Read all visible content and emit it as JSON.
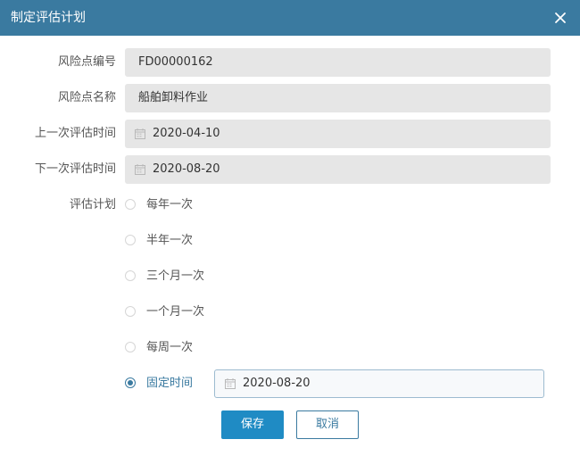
{
  "dialog": {
    "title": "制定评估计划",
    "close_icon": "close-icon"
  },
  "form": {
    "risk_code": {
      "label": "风险点编号",
      "value": "FD00000162"
    },
    "risk_name": {
      "label": "风险点名称",
      "value": "船舶卸料作业"
    },
    "last_eval": {
      "label": "上一次评估时间",
      "value": "2020-04-10",
      "icon": "calendar-icon"
    },
    "next_eval": {
      "label": "下一次评估时间",
      "value": "2020-08-20",
      "icon": "calendar-icon"
    },
    "plan": {
      "label": "评估计划",
      "selected": "固定时间",
      "options": [
        "每年一次",
        "半年一次",
        "三个月一次",
        "一个月一次",
        "每周一次",
        "固定时间"
      ],
      "fixed_date": "2020-08-20"
    }
  },
  "buttons": {
    "save": "保存",
    "cancel": "取消"
  },
  "colors": {
    "titlebar": "#3a7aa0",
    "primary_button": "#1f8bc4",
    "field_background": "#e6e6e6"
  }
}
